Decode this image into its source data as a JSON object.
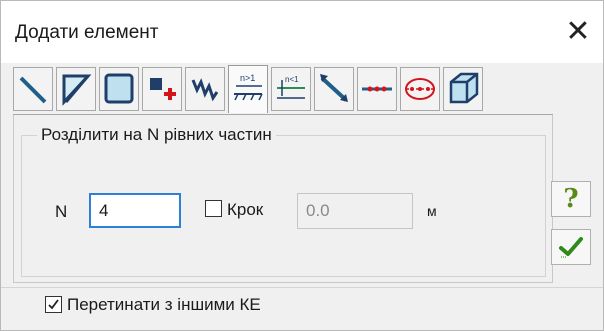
{
  "dialog": {
    "title": "Додати елемент",
    "close_symbol": "✕"
  },
  "toolbar": {
    "tools": [
      {
        "icon": "line-element-icon",
        "active": false
      },
      {
        "icon": "triangle-plate-icon",
        "active": false
      },
      {
        "icon": "quad-plate-icon",
        "active": false
      },
      {
        "icon": "add-node-icon",
        "active": false
      },
      {
        "icon": "spring-element-icon",
        "active": false
      },
      {
        "icon": "divide-n-equal-icon",
        "active": true
      },
      {
        "icon": "divide-n-less-one-icon",
        "active": false
      },
      {
        "icon": "divide-step-icon",
        "active": false
      },
      {
        "icon": "divide-by-nodes-icon",
        "active": false
      },
      {
        "icon": "ellipse-contour-icon",
        "active": false
      },
      {
        "icon": "solid-element-icon",
        "active": false
      }
    ]
  },
  "panel": {
    "group_title": "Розділити на N рівних частин",
    "n_label": "N",
    "n_value": "4",
    "step_checkbox_label": "Крок",
    "step_checked": false,
    "step_value": "0.0",
    "step_unit": "м"
  },
  "side_buttons": {
    "help_symbol": "?",
    "ok_icon": "checkmark-icon"
  },
  "footer": {
    "intersect_label": "Перетинати з іншими КЕ",
    "intersect_checked": true
  },
  "colors": {
    "focus_border": "#2f7fd8",
    "help_green": "#5b8a1a",
    "ok_green": "#2f8a1a"
  }
}
